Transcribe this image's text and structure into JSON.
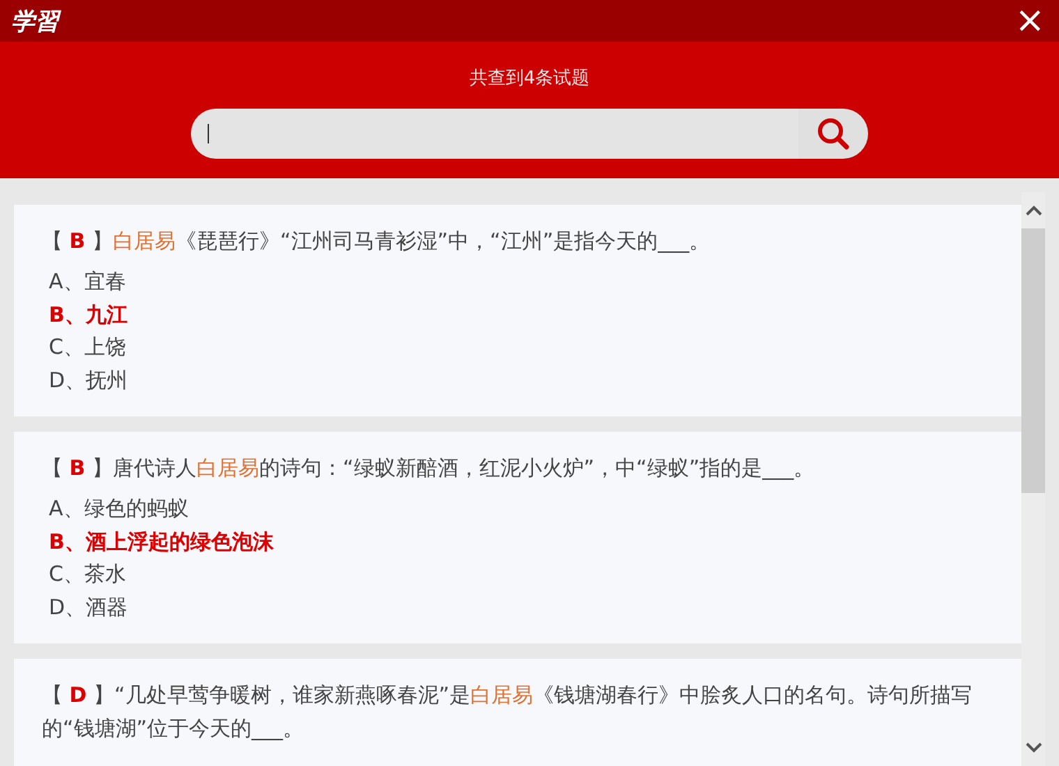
{
  "window": {
    "logo": "学習",
    "close": "×"
  },
  "header": {
    "result_count": "共查到4条试题"
  },
  "questions": [
    {
      "open_bracket": "【",
      "answer": "B",
      "close_bracket": "】",
      "parts": [
        {
          "text": "白居易",
          "highlight": true
        },
        {
          "text": "《琵琶行》“江州司马青衫湿”中，“江州”是指今天的___。",
          "highlight": false
        }
      ],
      "options": [
        {
          "text": "A、宜春",
          "correct": false
        },
        {
          "text": "B、九江",
          "correct": true
        },
        {
          "text": "C、上饶",
          "correct": false
        },
        {
          "text": "D、抚州",
          "correct": false
        }
      ]
    },
    {
      "open_bracket": "【",
      "answer": "B",
      "close_bracket": "】",
      "parts": [
        {
          "text": "唐代诗人",
          "highlight": false
        },
        {
          "text": "白居易",
          "highlight": true
        },
        {
          "text": "的诗句：“绿蚁新醅酒，红泥小火炉”，中“绿蚁”指的是___。",
          "highlight": false
        }
      ],
      "options": [
        {
          "text": "A、绿色的蚂蚁",
          "correct": false
        },
        {
          "text": "B、酒上浮起的绿色泡沫",
          "correct": true
        },
        {
          "text": "C、茶水",
          "correct": false
        },
        {
          "text": "D、酒器",
          "correct": false
        }
      ]
    },
    {
      "open_bracket": "【",
      "answer": "D",
      "close_bracket": "】",
      "parts": [
        {
          "text": "“几处早莺争暖树，谁家新燕啄春泥”是",
          "highlight": false
        },
        {
          "text": "白居易",
          "highlight": true
        },
        {
          "text": "《钱塘湖春行》中脍炙人口的名句。诗句所描写的“钱塘湖”位于今天的___。",
          "highlight": false
        }
      ]
    }
  ]
}
